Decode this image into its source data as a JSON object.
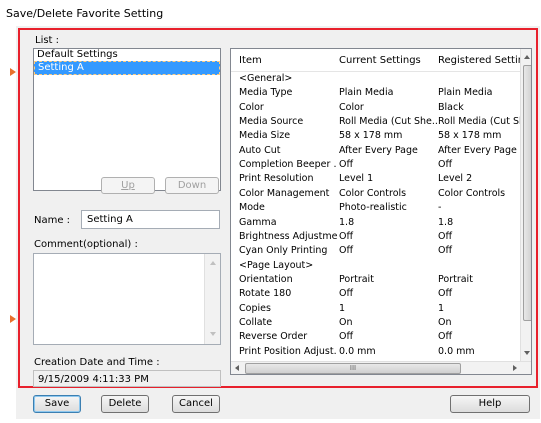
{
  "window": {
    "title": "Save/Delete Favorite Setting"
  },
  "list": {
    "label": "List :",
    "items": [
      {
        "label": "Default Settings",
        "selected": false
      },
      {
        "label": "Setting A",
        "selected": true
      }
    ],
    "up_label": "Up",
    "down_label": "Down"
  },
  "name": {
    "label": "Name :",
    "value": "Setting A"
  },
  "comment": {
    "label": "Comment(optional) :",
    "value": ""
  },
  "creation": {
    "label": "Creation Date and Time :",
    "value": "9/15/2009 4:11:33 PM"
  },
  "grid": {
    "columns": [
      "Item",
      "Current Settings",
      "Registered Settings"
    ],
    "rows": [
      [
        "<General>",
        "",
        ""
      ],
      [
        "Media Type",
        "Plain Media",
        "Plain Media"
      ],
      [
        "Color",
        "Color",
        "Black"
      ],
      [
        "Media Source",
        "Roll Media (Cut She...",
        "Roll Media (Cut She"
      ],
      [
        "Media Size",
        "58 x 178 mm",
        "58 x 178 mm"
      ],
      [
        "Auto Cut",
        "After Every Page",
        "After Every Page"
      ],
      [
        "Completion Beeper ...",
        "Off",
        "Off"
      ],
      [
        "Print Resolution",
        "Level 1",
        "Level 2"
      ],
      [
        "Color Management",
        "Color Controls",
        "Color Controls"
      ],
      [
        "Mode",
        "Photo-realistic",
        "-"
      ],
      [
        "Gamma",
        "1.8",
        "1.8"
      ],
      [
        "Brightness Adjustment",
        "Off",
        "Off"
      ],
      [
        "Cyan Only Printing",
        "Off",
        "Off"
      ],
      [
        "<Page Layout>",
        "",
        ""
      ],
      [
        "Orientation",
        "Portrait",
        "Portrait"
      ],
      [
        "Rotate 180",
        "Off",
        "Off"
      ],
      [
        "Copies",
        "1",
        "1"
      ],
      [
        "Collate",
        "On",
        "On"
      ],
      [
        "Reverse Order",
        "Off",
        "Off"
      ],
      [
        "Print Position Adjust...",
        "0.0 mm",
        "0.0 mm"
      ]
    ],
    "hscroll_glyph": "III"
  },
  "footer": {
    "save_label": "Save",
    "delete_label": "Delete",
    "cancel_label": "Cancel",
    "help_label": "Help"
  },
  "colors": {
    "highlight": "#e8202c",
    "selection": "#3399ff",
    "pointer": "#e8702c"
  }
}
